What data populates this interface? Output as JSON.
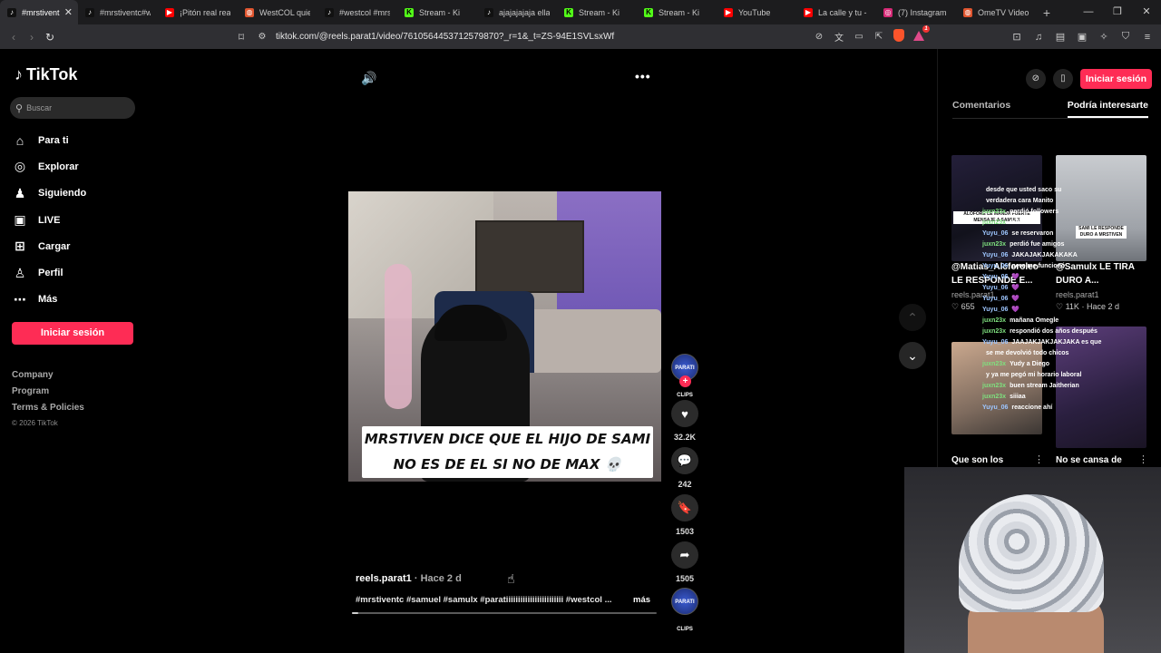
{
  "browser": {
    "tabs": [
      {
        "label": "#mrstivent",
        "favicon": "tiktok-icon",
        "active": true
      },
      {
        "label": "#mrstiventc#w",
        "favicon": "tiktok-icon"
      },
      {
        "label": "¡Pitón real reac",
        "favicon": "youtube-icon"
      },
      {
        "label": "WestCOL quien",
        "favicon": "generic-icon"
      },
      {
        "label": "#westcol #mrst",
        "favicon": "tiktok-icon"
      },
      {
        "label": "Stream - Ki",
        "favicon": "kick-icon"
      },
      {
        "label": "ajajajajaja ella",
        "favicon": "tiktok-icon"
      },
      {
        "label": "Stream - Ki",
        "favicon": "kick-icon"
      },
      {
        "label": "Stream - Ki",
        "favicon": "kick-icon"
      },
      {
        "label": "YouTube",
        "favicon": "youtube-icon"
      },
      {
        "label": "La calle y tu - M",
        "favicon": "youtube-icon"
      },
      {
        "label": "(7) Instagram",
        "favicon": "instagram-icon"
      },
      {
        "label": "OmeTV Video (",
        "favicon": "generic-icon"
      }
    ],
    "url": "tiktok.com/@reels.parat1/video/7610564453712579870?_r=1&_t=ZS-94E1SVLsxWf"
  },
  "tiktok": {
    "logo": "TikTok",
    "search_placeholder": "Buscar",
    "nav": [
      {
        "label": "Para ti",
        "icon": "home-icon"
      },
      {
        "label": "Explorar",
        "icon": "compass-icon"
      },
      {
        "label": "Siguiendo",
        "icon": "following-icon"
      },
      {
        "label": "LIVE",
        "icon": "live-icon"
      },
      {
        "label": "Cargar",
        "icon": "upload-icon"
      },
      {
        "label": "Perfil",
        "icon": "profile-icon"
      },
      {
        "label": "Más",
        "icon": "more-icon"
      }
    ],
    "login_label": "Iniciar sesión",
    "footer": {
      "company": "Company",
      "program": "Program",
      "terms": "Terms & Policies",
      "copyright": "© 2026 TikTok"
    }
  },
  "video": {
    "caption_line1": "MRSTIVEN DICE QUE EL HIJO DE SAMI",
    "caption_line2": "NO ES DE EL SI NO DE MAX",
    "caption_emoji": "💀",
    "avatar_text": "PARATI CLIPS",
    "likes": "32.2K",
    "comments": "242",
    "saves": "1503",
    "shares": "1505",
    "author": "reels.parat1",
    "time": "Hace 2 d",
    "hashtags": "#mrstiventc #samuel #samulx #paratiiiiiiiiiiiiiiiiiiiiiiii #westcol ...",
    "more_label": "más",
    "progress": 0.02
  },
  "right_panel": {
    "login_label": "Iniciar sesión",
    "tabs": [
      "Comentarios",
      "Podría interesarte"
    ],
    "active_tab": 1,
    "recommendations": [
      {
        "title": "@Matias_Alcforoleo LE RESPONDE E...",
        "user": "reels.parat1",
        "likes": "655"
      },
      {
        "title": "@Samulx LE TIRA DURO A...",
        "user": "reels.parat1",
        "likes": "11K",
        "time": "Hace 2 d"
      },
      {
        "title": "Que son los"
      },
      {
        "title": "No se cansa de"
      }
    ],
    "thumb_captions": [
      "ALOFORE LE MANDA FUERTE MENSAJE A SAMULX",
      "SAMI LE RESPONDE DURO A MRSTIVEN"
    ]
  },
  "chat": [
    {
      "user": "",
      "msg": "desde que usted saco su",
      "color": "green"
    },
    {
      "user": "",
      "msg": "verdadera cara Manito",
      "color": "green"
    },
    {
      "user": "juxn23x",
      "msg": "perdió followers",
      "color": "green"
    },
    {
      "user": "juxn23x",
      "msg": "followers",
      "color": "green"
    },
    {
      "user": "Yuyu_06",
      "msg": "se reservaron",
      "color": "blue"
    },
    {
      "user": "juxn23x",
      "msg": "perdió fue amigos",
      "color": "green"
    },
    {
      "user": "Yuyu_06",
      "msg": "JAKAJAKJAKAKAKA",
      "color": "blue"
    },
    {
      "user": "Yuyu_06",
      "msg": "pero me funcionó",
      "color": "blue"
    },
    {
      "user": "Yuyu_06",
      "msg": "💜",
      "color": "blue"
    },
    {
      "user": "Yuyu_06",
      "msg": "💜",
      "color": "blue"
    },
    {
      "user": "Yuyu_06",
      "msg": "💜",
      "color": "blue"
    },
    {
      "user": "Yuyu_06",
      "msg": "💜",
      "color": "blue"
    },
    {
      "user": "juxn23x",
      "msg": "mañana Omegle",
      "color": "green"
    },
    {
      "user": "juxn23x",
      "msg": "respondió dos años después",
      "color": "green"
    },
    {
      "user": "Yuyu_06",
      "msg": "JAAJAKJAKJAKJAKA es que",
      "color": "blue"
    },
    {
      "user": "",
      "msg": "se me devolvió todo chicos",
      "color": "green"
    },
    {
      "user": "juxn23x",
      "msg": "Yudy a Diego",
      "color": "green"
    },
    {
      "user": "",
      "msg": "y ya me pegó mi horario laboral",
      "color": "green"
    },
    {
      "user": "juxn23x",
      "msg": "buen stream Jaitherian",
      "color": "green"
    },
    {
      "user": "juxn23x",
      "msg": "siiiaa",
      "color": "green"
    },
    {
      "user": "Yuyu_06",
      "msg": "reaccione ahí",
      "color": "blue"
    }
  ]
}
